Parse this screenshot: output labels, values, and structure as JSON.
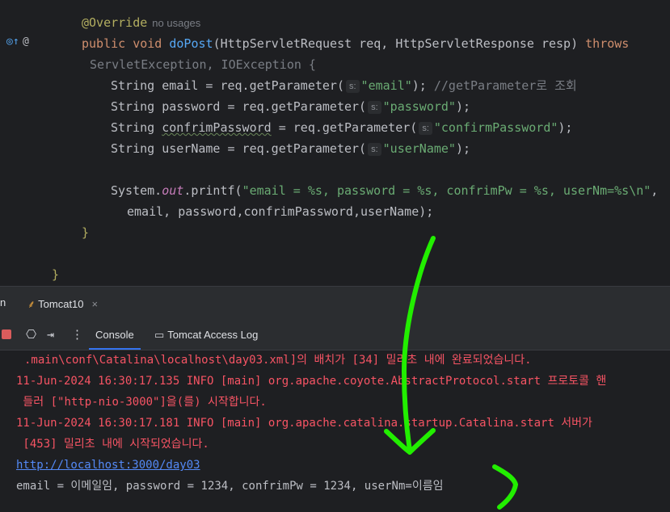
{
  "editor": {
    "usages_hint": "no usages",
    "param_hint": "s:",
    "lines": {
      "override": "@Override",
      "sig_public": "public void ",
      "sig_name": "doPost",
      "sig_args": "(HttpServletRequest req, HttpServletResponse resp) ",
      "sig_throws": "throws",
      "exceptions": "ServletException, IOException {",
      "l1_pre": "String email = req.getParameter(",
      "l1_str": "\"email\"",
      "l1_post": "); ",
      "l1_cmt": "//getParameter로 조회",
      "l2_pre": "String password = req.getParameter(",
      "l2_str": "\"password\"",
      "l2_post": ");",
      "l3_a": "String ",
      "l3_var": "confrimPassword",
      "l3_b": " = req.getParameter(",
      "l3_str": "\"confirmPassword\"",
      "l3_post": ");",
      "l4_pre": "String userName = req.getParameter(",
      "l4_str": "\"userName\"",
      "l4_post": ");",
      "l5_sys": "System.",
      "l5_out": "out",
      "l5_printf": ".printf(",
      "l5_str": "\"email = %s, password = %s, confrimPw = %s, userNm=%s\\n\"",
      "l5_end": ",",
      "l6": "email, password,confrimPassword,userName);",
      "close_method": "}",
      "close_class": "}"
    }
  },
  "run": {
    "left_label": "n",
    "tab_label": "Tomcat10",
    "tab_close": "×"
  },
  "toolbar": {
    "console_tab": "Console",
    "access_log_tab": "Tomcat Access Log"
  },
  "console": {
    "lines": [
      ".main\\conf\\Catalina\\localhost\\day03.xml]의 배치가 [34] 밀리초 내에 완료되었습니다.",
      "11-Jun-2024 16:30:17.135 INFO [main] org.apache.coyote.AbstractProtocol.start 프로토콜 핸",
      " 들러 [\"http-nio-3000\"]을(를) 시작합니다.",
      "11-Jun-2024 16:30:17.181 INFO [main] org.apache.catalina.startup.Catalina.start 서버가",
      " [453] 밀리초 내에 시작되었습니다."
    ],
    "link": "http://localhost:3000/day03",
    "output": "email = 이메일임, password = 1234, confrimPw = 1234, userNm=이름임"
  },
  "colors": {
    "annotation_stroke": "#22ee00"
  }
}
